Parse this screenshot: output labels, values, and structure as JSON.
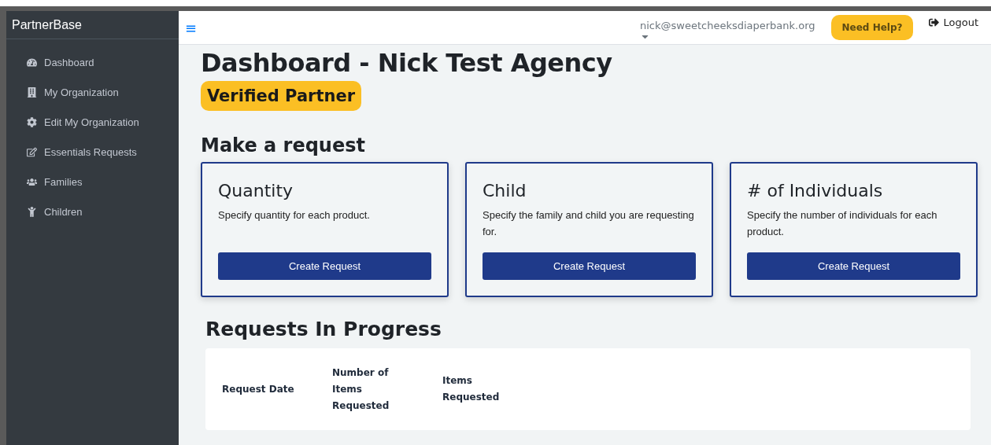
{
  "sidebar": {
    "brand": "PartnerBase",
    "items": [
      {
        "label": "Dashboard"
      },
      {
        "label": "My Organization"
      },
      {
        "label": "Edit My Organization"
      },
      {
        "label": "Essentials Requests"
      },
      {
        "label": "Families"
      },
      {
        "label": "Children"
      }
    ]
  },
  "topbar": {
    "menu_icon": "≡",
    "user": "nick@sweetcheeksdiaperbank.org",
    "help": "Need Help?",
    "logout": "Logout"
  },
  "page": {
    "title": "Dashboard - Nick Test Agency",
    "badge": "Verified Partner",
    "section": "Make a request",
    "cards": [
      {
        "title": "Quantity",
        "text": "Specify quantity for each product.",
        "button": "Create Request"
      },
      {
        "title": "Child",
        "text": "Specify the family and child you are requesting for.",
        "button": "Create Request"
      },
      {
        "title": "# of Individuals",
        "text": "Specify the number of individuals for each product.",
        "button": "Create Request"
      }
    ],
    "progress_title": "Requests In Progress",
    "table": {
      "columns": [
        "Request Date",
        "Number of Items Requested",
        "Items Requested"
      ]
    }
  }
}
